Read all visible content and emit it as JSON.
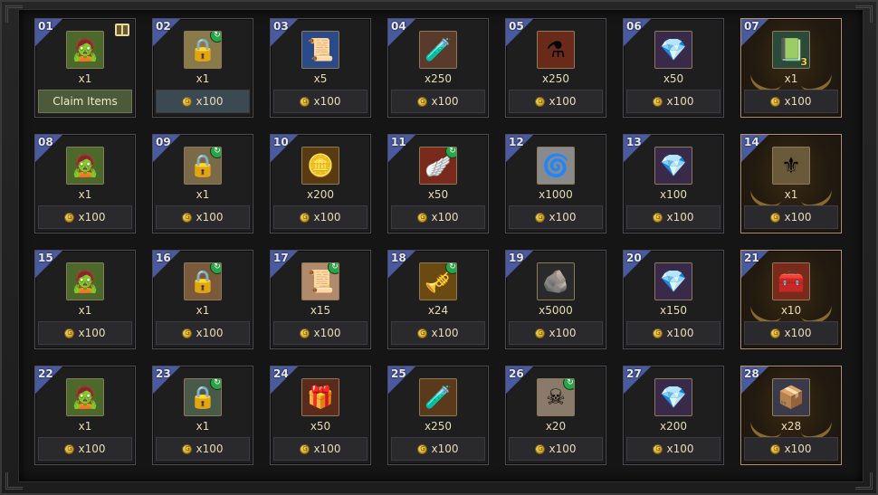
{
  "currency_icon": "gold-coin-icon",
  "claim_label": "Claim Items",
  "cells": [
    {
      "num": "01",
      "icon": "zombie-figure-icon",
      "glyph": "🧟",
      "bg": "#4b6a2a",
      "qty": "x1",
      "cost": "",
      "claim": true,
      "gift": true
    },
    {
      "num": "02",
      "icon": "locked-chest-icon",
      "glyph": "🔒",
      "bg": "#8a7a4a",
      "qty": "x1",
      "cost": "x100",
      "badge": true,
      "active": true
    },
    {
      "num": "03",
      "icon": "blue-scroll-icon",
      "glyph": "📜",
      "bg": "#2a4a8a",
      "qty": "x5",
      "cost": "x100"
    },
    {
      "num": "04",
      "icon": "blue-potion-icon",
      "glyph": "🧪",
      "bg": "#5a3a2a",
      "qty": "x250",
      "cost": "x100"
    },
    {
      "num": "05",
      "icon": "red-potion-icon",
      "glyph": "⚗",
      "bg": "#6a2a1a",
      "qty": "x250",
      "cost": "x100"
    },
    {
      "num": "06",
      "icon": "crystal-icon",
      "glyph": "💎",
      "bg": "#3a2a4a",
      "qty": "x50",
      "cost": "x100"
    },
    {
      "num": "07",
      "icon": "green-tome-icon",
      "glyph": "📗",
      "bg": "#2a4a3a",
      "qty": "x1",
      "cost": "x100",
      "special": true,
      "stack": "3"
    },
    {
      "num": "08",
      "icon": "zombie-figure-icon",
      "glyph": "🧟",
      "bg": "#4b6a2a",
      "qty": "x1",
      "cost": "x100"
    },
    {
      "num": "09",
      "icon": "locked-chest-icon",
      "glyph": "🔒",
      "bg": "#7a6a4a",
      "qty": "x1",
      "cost": "x100",
      "badge": true
    },
    {
      "num": "10",
      "icon": "gold-medal-icon",
      "glyph": "🪙",
      "bg": "#5a3a10",
      "qty": "x200",
      "cost": "x100"
    },
    {
      "num": "11",
      "icon": "golden-wing-icon",
      "glyph": "🪽",
      "bg": "#7a2a1a",
      "qty": "x50",
      "cost": "x100",
      "badge": true
    },
    {
      "num": "12",
      "icon": "spiral-scroll-icon",
      "glyph": "🌀",
      "bg": "#8a8a8a",
      "qty": "x1000",
      "cost": "x100"
    },
    {
      "num": "13",
      "icon": "crystal-icon",
      "glyph": "💎",
      "bg": "#3a2a4a",
      "qty": "x100",
      "cost": "x100"
    },
    {
      "num": "14",
      "icon": "rank-emblem-icon",
      "glyph": "⚜",
      "bg": "#6a5a3a",
      "qty": "x1",
      "cost": "x100",
      "special": true
    },
    {
      "num": "15",
      "icon": "zombie-figure-icon",
      "glyph": "🧟",
      "bg": "#4b6a2a",
      "qty": "x1",
      "cost": "x100"
    },
    {
      "num": "16",
      "icon": "locked-chest-icon",
      "glyph": "🔒",
      "bg": "#7a5a3a",
      "qty": "x1",
      "cost": "x100",
      "badge": true
    },
    {
      "num": "17",
      "icon": "parchment-scroll-icon",
      "glyph": "📜",
      "bg": "#b08a6a",
      "qty": "x15",
      "cost": "x100",
      "badge": true
    },
    {
      "num": "18",
      "icon": "golden-horn-icon",
      "glyph": "🎺",
      "bg": "#6a4a10",
      "qty": "x24",
      "cost": "x100",
      "badge": true
    },
    {
      "num": "19",
      "icon": "iron-ore-icon",
      "glyph": "🪨",
      "bg": "#2a2a2a",
      "qty": "x5000",
      "cost": "x100"
    },
    {
      "num": "20",
      "icon": "crystal-icon",
      "glyph": "💎",
      "bg": "#3a2a4a",
      "qty": "x150",
      "cost": "x100"
    },
    {
      "num": "21",
      "icon": "treasure-chest-icon",
      "glyph": "🧰",
      "bg": "#7a2a1a",
      "qty": "x10",
      "cost": "x100",
      "special": true
    },
    {
      "num": "22",
      "icon": "zombie-figure-icon",
      "glyph": "🧟",
      "bg": "#4b6a2a",
      "qty": "x1",
      "cost": "x100"
    },
    {
      "num": "23",
      "icon": "locked-chest-icon",
      "glyph": "🔒",
      "bg": "#4a5a4a",
      "qty": "x1",
      "cost": "x100",
      "badge": true
    },
    {
      "num": "24",
      "icon": "gift-box-icon",
      "glyph": "🎁",
      "bg": "#5a2a1a",
      "qty": "x50",
      "cost": "x100"
    },
    {
      "num": "25",
      "icon": "orange-potion-icon",
      "glyph": "🧪",
      "bg": "#5a3a1a",
      "qty": "x250",
      "cost": "x100"
    },
    {
      "num": "26",
      "icon": "skull-map-icon",
      "glyph": "☠",
      "bg": "#8a7a6a",
      "qty": "x20",
      "cost": "x100",
      "badge": true
    },
    {
      "num": "27",
      "icon": "crystal-icon",
      "glyph": "💎",
      "bg": "#3a2a4a",
      "qty": "x200",
      "cost": "x100"
    },
    {
      "num": "28",
      "icon": "steel-crate-icon",
      "glyph": "📦",
      "bg": "#3a3a4a",
      "qty": "x28",
      "cost": "x100",
      "special": true
    }
  ]
}
